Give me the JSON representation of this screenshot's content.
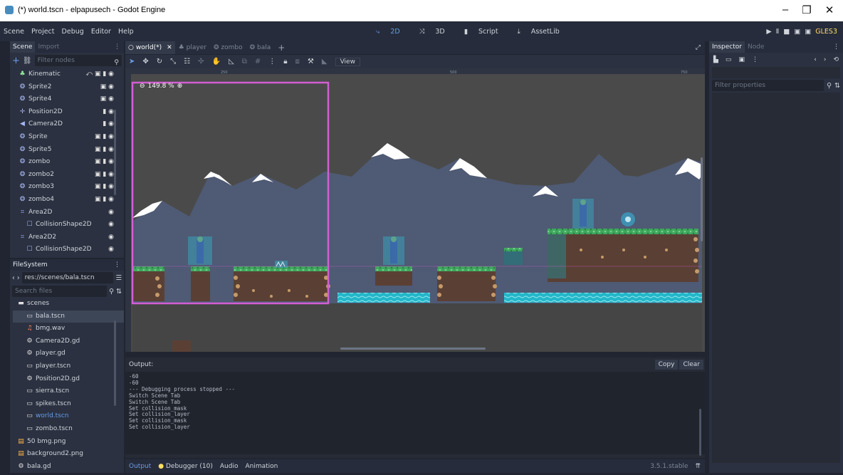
{
  "window": {
    "title": "(*) world.tscn - elpapusech - Godot Engine",
    "minimize": "–",
    "restore": "❐",
    "close": "✕"
  },
  "menu": {
    "items": [
      "Scene",
      "Project",
      "Debug",
      "Editor",
      "Help"
    ]
  },
  "workspaces": [
    {
      "label": "2D",
      "icon": "2d-icon",
      "active": true
    },
    {
      "label": "3D",
      "icon": "3d-icon"
    },
    {
      "label": "Script",
      "icon": "script-icon"
    },
    {
      "label": "AssetLib",
      "icon": "assetlib-icon"
    }
  ],
  "renderer": "GLES3",
  "scene_dock": {
    "tabs": [
      "Scene",
      "Import"
    ],
    "filter_placeholder": "Filter nodes",
    "nodes": [
      {
        "label": "Kinematic",
        "icon": "kinematic-icon",
        "flags": "⤺ ▣ ▮ ◉"
      },
      {
        "label": "Sprite2",
        "icon": "sprite-icon",
        "flags": "▣ ◉"
      },
      {
        "label": "Sprite4",
        "icon": "sprite-icon",
        "flags": "▣ ◉"
      },
      {
        "label": "Position2D",
        "icon": "position2d-icon",
        "flags": "▮ ◉"
      },
      {
        "label": "Camera2D",
        "icon": "camera-icon",
        "flags": "▮ ◉"
      },
      {
        "label": "Sprite",
        "icon": "sprite-icon",
        "flags": "▣ ▮ ◉"
      },
      {
        "label": "Sprite5",
        "icon": "sprite-icon",
        "flags": "▣ ▮ ◉"
      },
      {
        "label": "zombo",
        "icon": "instance-icon",
        "flags": "▣ ▮ ◉"
      },
      {
        "label": "zombo2",
        "icon": "instance-icon",
        "flags": "▣ ▮ ◉"
      },
      {
        "label": "zombo3",
        "icon": "instance-icon",
        "flags": "▣ ▮ ◉"
      },
      {
        "label": "zombo4",
        "icon": "instance-icon",
        "flags": "▣ ▮ ◉"
      },
      {
        "label": "Area2D",
        "icon": "area2d-icon",
        "flags": "◉"
      },
      {
        "label": "CollisionShape2D",
        "icon": "collision-icon",
        "flags": "◉"
      },
      {
        "label": "Area2D2",
        "icon": "area2d-icon",
        "flags": "◉"
      },
      {
        "label": "CollisionShape2D",
        "icon": "collision-icon",
        "flags": "◉"
      }
    ]
  },
  "filesystem": {
    "title": "FileSystem",
    "path": "res://scenes/bala.tscn",
    "search_placeholder": "Search files",
    "files": [
      {
        "label": "scenes",
        "icon": "folder-icon"
      },
      {
        "label": "bala.tscn",
        "icon": "scene-file-icon",
        "selected": true
      },
      {
        "label": "bmg.wav",
        "icon": "audio-file-icon"
      },
      {
        "label": "Camera2D.gd",
        "icon": "gear-icon"
      },
      {
        "label": "player.gd",
        "icon": "gear-icon"
      },
      {
        "label": "player.tscn",
        "icon": "scene-file-icon"
      },
      {
        "label": "Position2D.gd",
        "icon": "gear-icon"
      },
      {
        "label": "sierra.tscn",
        "icon": "scene-file-icon"
      },
      {
        "label": "spikes.tscn",
        "icon": "scene-file-icon"
      },
      {
        "label": "world.tscn",
        "icon": "scene-file-icon",
        "highlight": true
      },
      {
        "label": "zombo.tscn",
        "icon": "scene-file-icon"
      },
      {
        "label": "50 bmg.png",
        "icon": "image-file-icon"
      },
      {
        "label": "background2.png",
        "icon": "image-file-icon"
      },
      {
        "label": "bala.gd",
        "icon": "gear-icon"
      }
    ]
  },
  "editor_tabs": [
    {
      "label": "world(*)",
      "active": true
    },
    {
      "label": "player"
    },
    {
      "label": "zombo"
    },
    {
      "label": "bala"
    }
  ],
  "toolbar": {
    "view_label": "View"
  },
  "viewport": {
    "zoom": "149.8 %",
    "ruler_marks": [
      "250",
      "500",
      "750"
    ]
  },
  "output": {
    "title": "Output:",
    "copy_label": "Copy",
    "clear_label": "Clear",
    "lines": [
      "-60",
      "-60",
      "--- Debugging process stopped ---",
      "Switch Scene Tab",
      "Switch Scene Tab",
      "Set collision_mask",
      "Set collision_layer",
      "Set collision_mask",
      "Set collision_layer"
    ]
  },
  "bottom_tabs": [
    "Output",
    "Debugger (10)",
    "Audio",
    "Animation"
  ],
  "version": "3.5.1.stable",
  "inspector": {
    "tabs": [
      "Inspector",
      "Node"
    ],
    "filter_placeholder": "Filter properties"
  },
  "colors": {
    "accent": "#699ce8",
    "selection": "#d35fd3",
    "warning": "#ffdd65",
    "water": "#1fb3c7",
    "grass": "#4caf6a",
    "sky": "#4f5a74"
  }
}
